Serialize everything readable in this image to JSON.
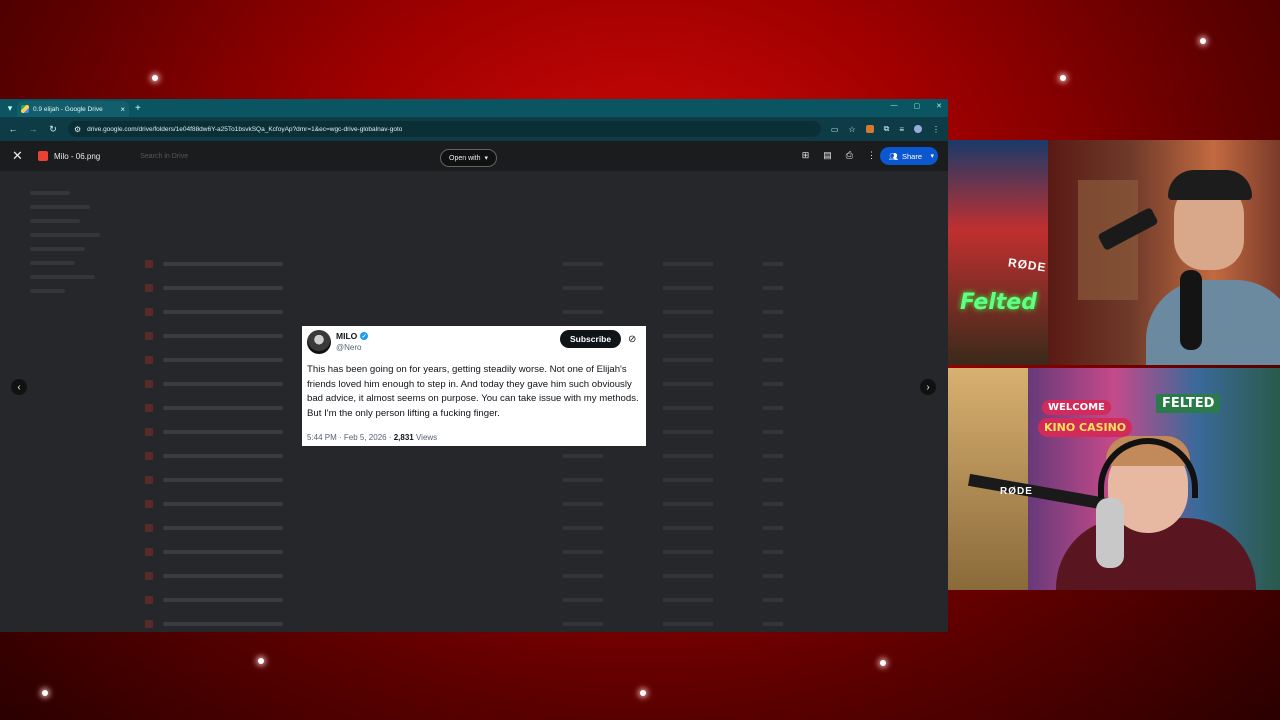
{
  "browser": {
    "tab_title": "0.9 elijah - Google Drive",
    "url": "drive.google.com/drive/folders/1e04f88dw6Y-a25To1bsvkSQa_KcfoyAp?dmr=1&ec=wgc-drive-globalnav-goto",
    "accent_color": "#0b5563"
  },
  "viewer": {
    "file_name": "Milo - 06.png",
    "search_placeholder": "Search in Drive",
    "open_with_label": "Open with",
    "share_label": "Share"
  },
  "tweet": {
    "name": "MILO",
    "handle": "@Nero",
    "subscribe_label": "Subscribe",
    "text": "This has been going on for years, getting steadily worse. Not one of Elijah's friends loved him enough to step in. And today they gave him such obviously bad advice, it almost seems on purpose. You can take issue with my methods. But I'm the only person lifting a fucking finger.",
    "timestamp": "5:44 PM · Feb 5, 2026 · ",
    "views_count": "2,831",
    "views_label": " Views",
    "verified_color": "#1d9bf0"
  },
  "stream": {
    "cam1_mic_brand": "RØDE",
    "cam1_sign": "Felted",
    "cam2_welcome": "WELCOME",
    "cam2_casino": "KINO CASINO",
    "cam2_felted": "FELTED",
    "cam2_mic_brand": "RØDE"
  }
}
